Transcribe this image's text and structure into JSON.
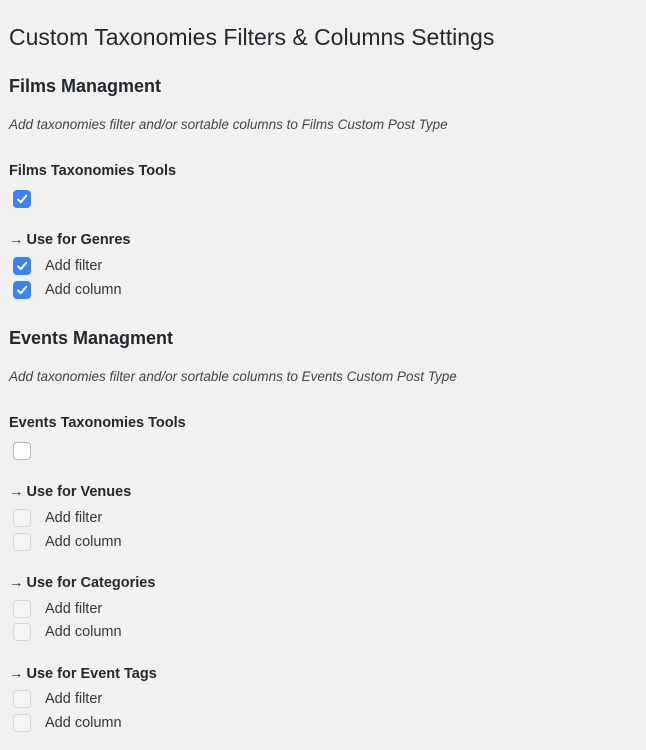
{
  "page": {
    "title": "Custom Taxonomies Filters & Columns Settings"
  },
  "sections": [
    {
      "title": "Films Managment",
      "description": "Add taxonomies filter and/or sortable columns to Films Custom Post Type",
      "tools_label": "Films Taxonomies Tools",
      "tools_checked": true,
      "taxonomies": [
        {
          "arrow": "→",
          "label": "Use for Genres",
          "filter_label": "Add filter",
          "filter_checked": true,
          "column_label": "Add column",
          "column_checked": true
        }
      ]
    },
    {
      "title": "Events Managment",
      "description": "Add taxonomies filter and/or sortable columns to Events Custom Post Type",
      "tools_label": "Events Taxonomies Tools",
      "tools_checked": false,
      "taxonomies": [
        {
          "arrow": "→",
          "label": "Use for Venues",
          "filter_label": "Add filter",
          "filter_checked": false,
          "column_label": "Add column",
          "column_checked": false
        },
        {
          "arrow": "→",
          "label": "Use for Categories",
          "filter_label": "Add filter",
          "filter_checked": false,
          "column_label": "Add column",
          "column_checked": false
        },
        {
          "arrow": "→",
          "label": "Use for Event Tags",
          "filter_label": "Add filter",
          "filter_checked": false,
          "column_label": "Add column",
          "column_checked": false
        }
      ]
    }
  ],
  "colors": {
    "background": "#f1f1f1",
    "checkbox_checked": "#3b82f6",
    "text": "#23282d"
  }
}
